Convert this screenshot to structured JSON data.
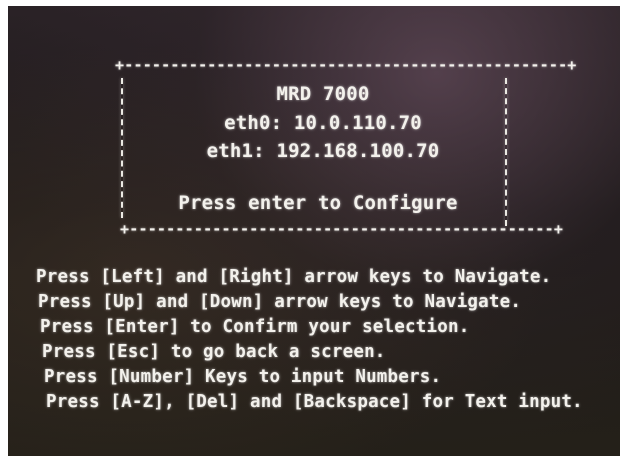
{
  "dialog": {
    "title": "MRD 7000",
    "eth0_line": "eth0: 10.0.110.70",
    "eth1_line": "eth1: 192.168.100.70",
    "prompt": "Press enter to Configure"
  },
  "help_lines": [
    "Press [Left] and [Right] arrow keys to Navigate.",
    "Press [Up] and [Down] arrow keys to Navigate.",
    "Press [Enter] to Confirm your selection.",
    "Press [Esc] to go back a screen.",
    "Press [Number] Keys to input Numbers.",
    "Press [A-Z], [Del] and [Backspace] for Text input."
  ],
  "colors": {
    "text": "#f3f1ec",
    "background": "#221d1e"
  }
}
